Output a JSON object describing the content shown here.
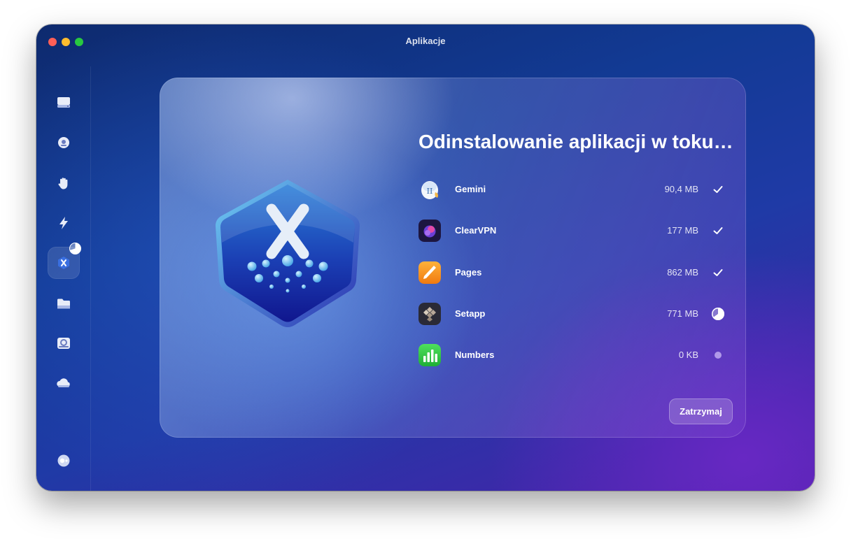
{
  "window": {
    "title": "Aplikacje"
  },
  "sidebar": {
    "items": [
      {
        "icon": "disk-icon"
      },
      {
        "icon": "shield-icon"
      },
      {
        "icon": "hand-icon"
      },
      {
        "icon": "lightning-icon"
      },
      {
        "icon": "app-uninstall-icon",
        "active": true
      },
      {
        "icon": "folder-icon"
      },
      {
        "icon": "space-lens-icon"
      },
      {
        "icon": "cloud-icon"
      },
      {
        "icon": "assistant-icon"
      }
    ]
  },
  "main": {
    "heading": "Odinstalowanie aplikacji w toku…",
    "apps": [
      {
        "name": "Gemini",
        "size": "90,4 MB",
        "status": "done",
        "icon": "gemini-icon"
      },
      {
        "name": "ClearVPN",
        "size": "177 MB",
        "status": "done",
        "icon": "clearvpn-icon"
      },
      {
        "name": "Pages",
        "size": "862 MB",
        "status": "done",
        "icon": "pages-icon"
      },
      {
        "name": "Setapp",
        "size": "771 MB",
        "status": "in-progress",
        "progress": 0.65,
        "icon": "setapp-icon"
      },
      {
        "name": "Numbers",
        "size": "0 KB",
        "status": "pending",
        "icon": "numbers-icon"
      }
    ],
    "stop_label": "Zatrzymaj"
  },
  "colors": {
    "accent_purple": "#4b23a8",
    "deep_blue": "#123a94",
    "traffic_close": "#ff5f57",
    "traffic_min": "#febc2e",
    "traffic_max": "#28c840"
  }
}
